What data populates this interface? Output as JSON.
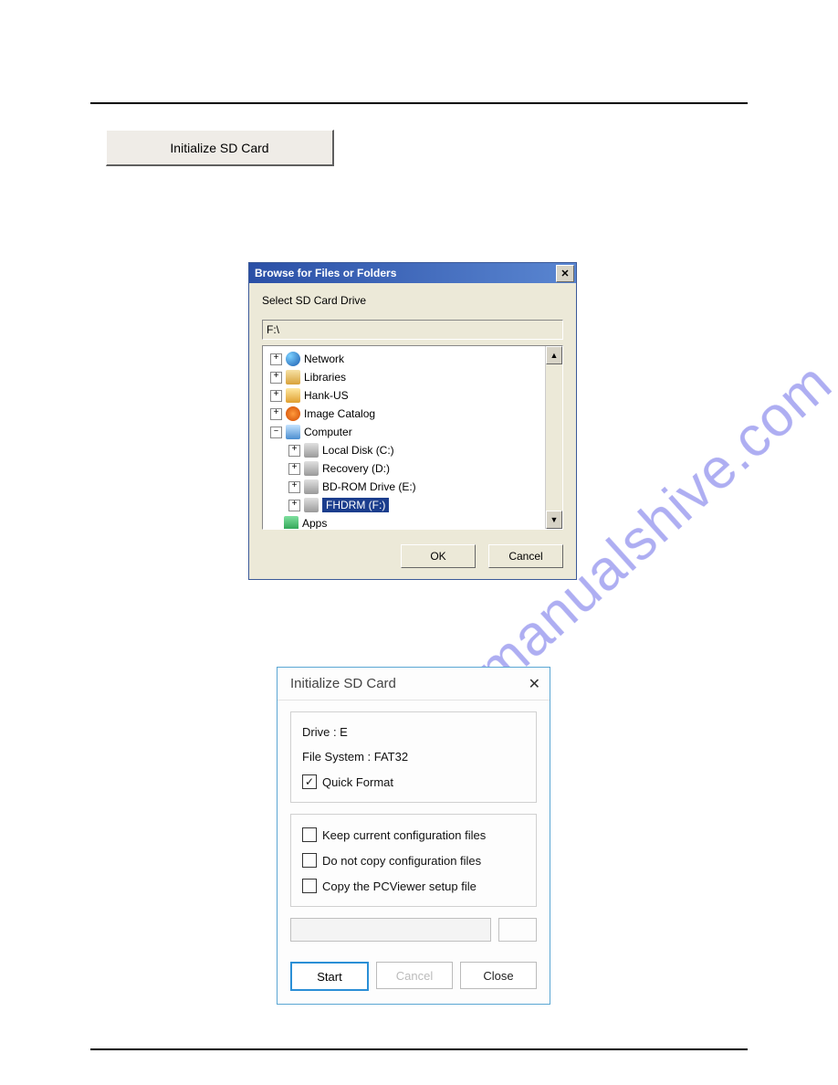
{
  "watermark": "manualshive.com",
  "topButton": {
    "label": "Initialize SD Card"
  },
  "browseDialog": {
    "title": "Browse for Files or Folders",
    "instruction": "Select SD Card Drive",
    "path": "F:\\",
    "tree": {
      "network": "Network",
      "libraries": "Libraries",
      "user": "Hank-US",
      "catalog": "Image Catalog",
      "computer": "Computer",
      "localDisk": "Local Disk (C:)",
      "recovery": "Recovery (D:)",
      "bdrom": "BD-ROM Drive (E:)",
      "fhdrm": "FHDRM (F:)",
      "apps": "Apps"
    },
    "okLabel": "OK",
    "cancelLabel": "Cancel"
  },
  "initDialog": {
    "title": "Initialize SD Card",
    "driveLabel": "Drive : E",
    "fsLabel": "File System : FAT32",
    "quickFormat": "Quick Format",
    "keepConfig": "Keep current configuration files",
    "noCopyConfig": "Do not copy configuration files",
    "copyPcViewer": "Copy the PCViewer setup file",
    "startLabel": "Start",
    "cancelLabel": "Cancel",
    "closeLabel": "Close"
  }
}
